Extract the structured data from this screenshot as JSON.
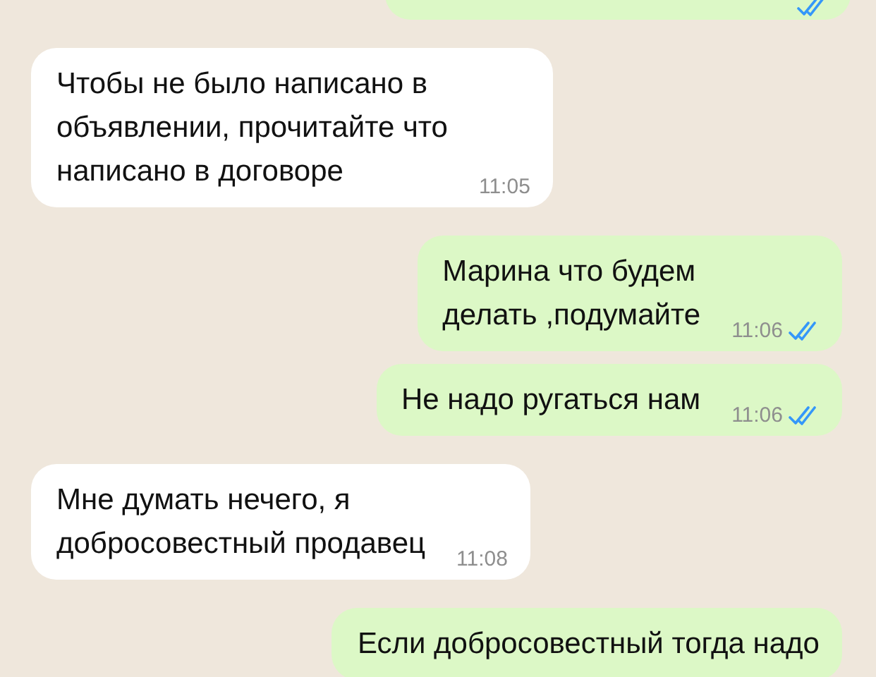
{
  "messages": [
    {
      "kind": "outgoing",
      "read": true
    },
    {
      "kind": "incoming",
      "text": "Чтобы не было написано в\nобъявлении, прочитайте что\nнаписано в договоре",
      "time": "11:05"
    },
    {
      "kind": "outgoing",
      "text": "Марина что будем\nделать ,подумайте",
      "time": "11:06",
      "read": true
    },
    {
      "kind": "outgoing",
      "text": "Не надо ругаться нам",
      "time": "11:06",
      "read": true
    },
    {
      "kind": "incoming",
      "text": "Мне думать нечего, я\nдобросовестный продавец",
      "time": "11:08"
    },
    {
      "kind": "outgoing",
      "text": "Если добросовестный тогда надо"
    }
  ]
}
